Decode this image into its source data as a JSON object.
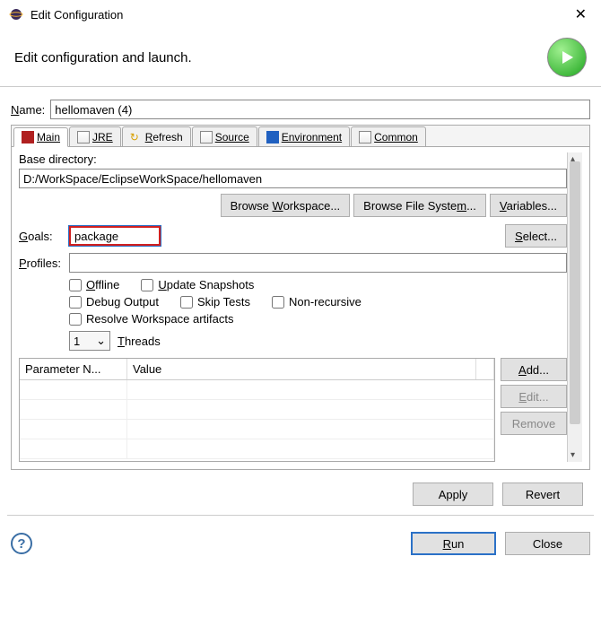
{
  "title": "Edit Configuration",
  "header_text": "Edit configuration and launch.",
  "name_label": "Name:",
  "name_value": "hellomaven (4)",
  "tabs": {
    "main": "Main",
    "jre": "JRE",
    "refresh": "Refresh",
    "source": "Source",
    "environment": "Environment",
    "common": "Common"
  },
  "base_dir_label": "Base directory:",
  "base_dir_value": "D:/WorkSpace/EclipseWorkSpace/hellomaven",
  "buttons": {
    "browse_workspace": "Browse Workspace...",
    "browse_filesystem": "Browse File System...",
    "variables": "Variables...",
    "select": "Select...",
    "add": "Add...",
    "edit": "Edit...",
    "remove": "Remove",
    "apply": "Apply",
    "revert": "Revert",
    "run": "Run",
    "close": "Close"
  },
  "goals_label": "Goals:",
  "goals_value": "package",
  "profiles_label": "Profiles:",
  "profiles_value": "",
  "checkboxes": {
    "offline": "Offline",
    "update_snapshots": "Update Snapshots",
    "debug_output": "Debug Output",
    "skip_tests": "Skip Tests",
    "non_recursive": "Non-recursive",
    "resolve_workspace": "Resolve Workspace artifacts"
  },
  "threads_label": "Threads",
  "threads_value": "1",
  "table": {
    "col_param": "Parameter N...",
    "col_value": "Value"
  }
}
